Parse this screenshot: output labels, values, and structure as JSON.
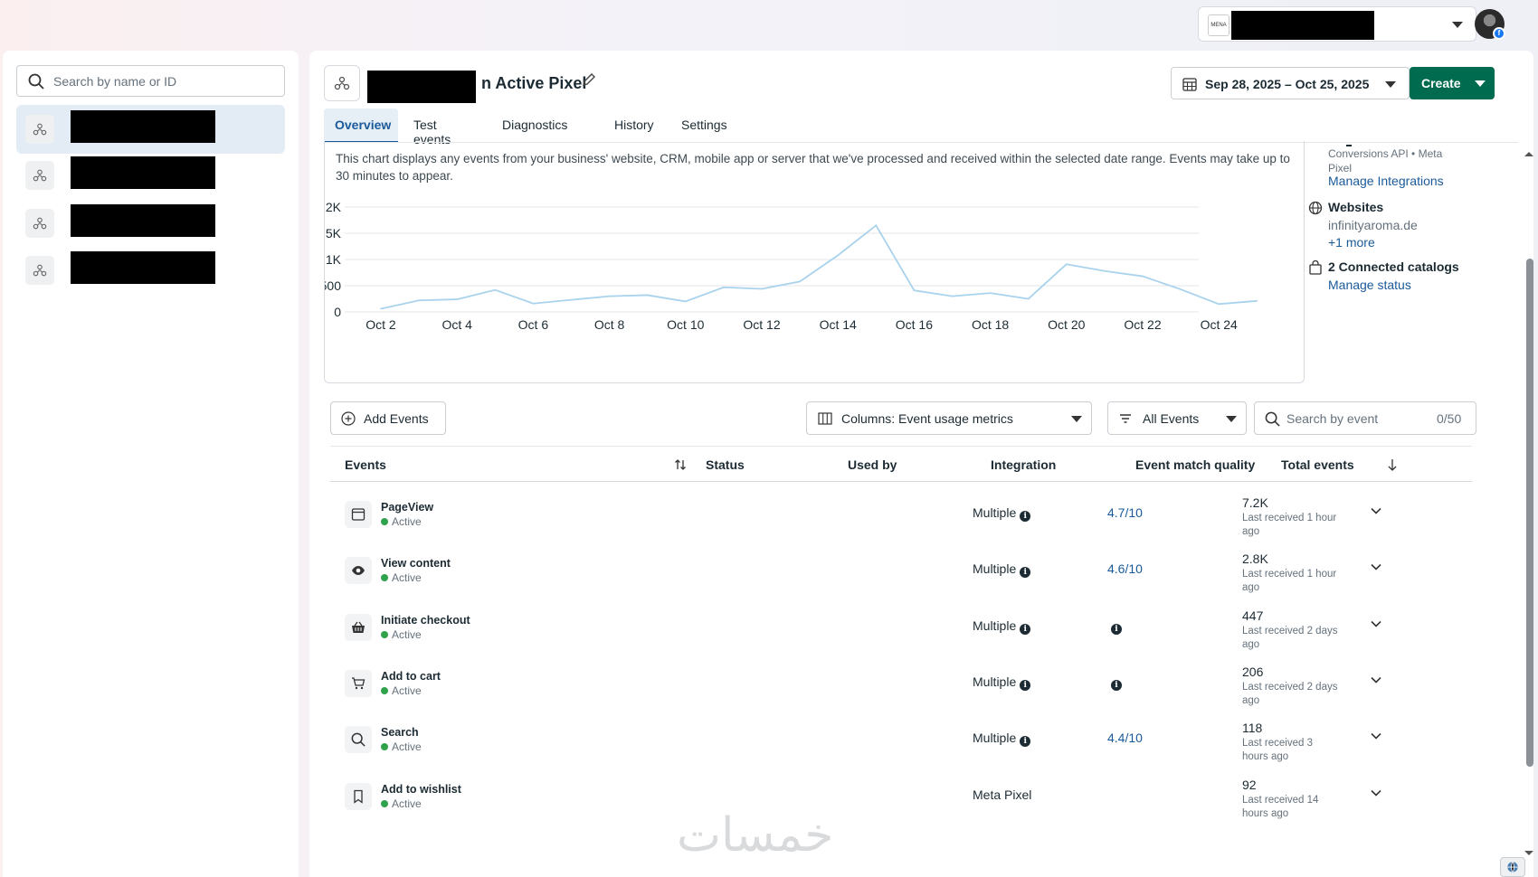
{
  "topbar": {
    "account_logo_text": "MENA"
  },
  "left_panel": {
    "search_placeholder": "Search by name or ID",
    "items": [
      {
        "selected": true
      },
      {
        "selected": false
      },
      {
        "selected": false
      },
      {
        "selected": false
      }
    ]
  },
  "header": {
    "title_suffix": "n Active Pixel",
    "date_range": "Sep 28, 2025 – Oct 25, 2025",
    "create_label": "Create"
  },
  "tabs": [
    {
      "label": "Overview",
      "active": true
    },
    {
      "label": "Test events",
      "active": false
    },
    {
      "label": "Diagnostics",
      "active": false
    },
    {
      "label": "History",
      "active": false
    },
    {
      "label": "Settings",
      "active": false
    }
  ],
  "chart_description": "This chart displays any events from your business' website, CRM, mobile app or server that we've processed and received within the selected date range. Events may take up to 30 minutes to appear.",
  "chart_data": {
    "type": "line",
    "x_ticks": [
      "Oct 2",
      "Oct 4",
      "Oct 6",
      "Oct 8",
      "Oct 10",
      "Oct 12",
      "Oct 14",
      "Oct 16",
      "Oct 18",
      "Oct 20",
      "Oct 22",
      "Oct 24"
    ],
    "y_ticks": [
      "0",
      "500",
      "1K",
      "1.5K",
      "2K"
    ],
    "ylim": [
      0,
      2000
    ],
    "x_days": [
      2,
      3,
      4,
      5,
      6,
      7,
      8,
      9,
      10,
      11,
      12,
      13,
      14,
      15,
      16,
      17,
      18,
      19,
      20,
      21,
      22,
      23,
      24,
      25
    ],
    "values": [
      60,
      220,
      240,
      420,
      160,
      230,
      300,
      320,
      200,
      470,
      440,
      580,
      1080,
      1650,
      410,
      300,
      360,
      250,
      910,
      780,
      680,
      430,
      150,
      210
    ],
    "color": "#a9d3ec",
    "grid": true
  },
  "side_info": {
    "partial_top": "Conversions API • Meta Pixel",
    "manage_integrations": "Manage Integrations",
    "websites_label": "Websites",
    "website_domain": "infinityaroma.de",
    "more_link": "+1 more",
    "catalogs_label": "2 Connected catalogs",
    "manage_status": "Manage status"
  },
  "toolbar": {
    "add_events": "Add Events",
    "columns_label": "Columns: Event usage metrics",
    "filter_label": "All Events",
    "search_placeholder": "Search by event",
    "search_count": "0/50"
  },
  "table": {
    "headers": [
      "Events",
      "Status",
      "Used by",
      "Integration",
      "Event match quality",
      "Total events"
    ],
    "rows": [
      {
        "icon": "browser-icon",
        "name": "PageView",
        "status": "Active",
        "integration": "Multiple",
        "emq": "4.7/10",
        "total": "7.2K",
        "last": "Last received 1 hour ago"
      },
      {
        "icon": "eye-icon",
        "name": "View content",
        "status": "Active",
        "integration": "Multiple",
        "emq": "4.6/10",
        "total": "2.8K",
        "last": "Last received 1 hour ago"
      },
      {
        "icon": "basket-icon",
        "name": "Initiate checkout",
        "status": "Active",
        "integration": "Multiple",
        "emq": "",
        "total": "447",
        "last": "Last received 2 days ago"
      },
      {
        "icon": "cart-icon",
        "name": "Add to cart",
        "status": "Active",
        "integration": "Multiple",
        "emq": "",
        "total": "206",
        "last": "Last received 2 days ago"
      },
      {
        "icon": "search-icon",
        "name": "Search",
        "status": "Active",
        "integration": "Multiple",
        "emq": "4.4/10",
        "total": "118",
        "last": "Last received 3 hours ago"
      },
      {
        "icon": "bookmark-icon",
        "name": "Add to wishlist",
        "status": "Active",
        "integration": "Meta Pixel",
        "emq": "",
        "total": "92",
        "last": "Last received 14 hours ago"
      }
    ]
  },
  "watermark": "خمسات"
}
